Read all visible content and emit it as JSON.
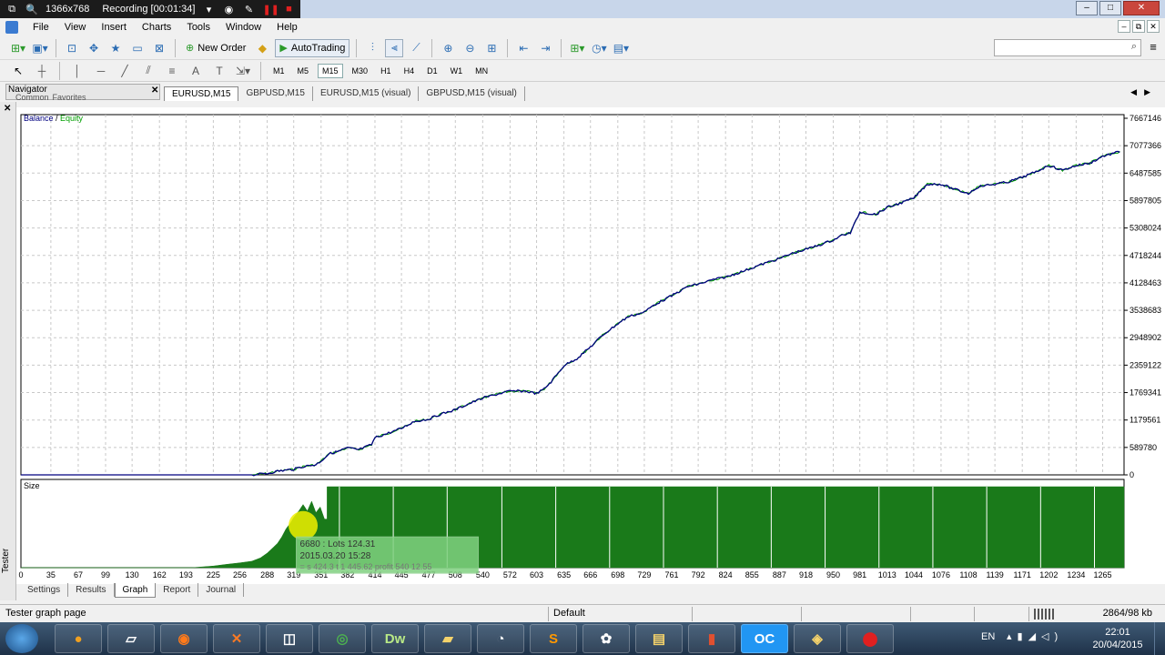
{
  "recorder": {
    "resolution": "1366x768",
    "status": "Recording [00:01:34]"
  },
  "menu": {
    "items": [
      "File",
      "View",
      "Insert",
      "Charts",
      "Tools",
      "Window",
      "Help"
    ]
  },
  "toolbar": {
    "new_order": "New Order",
    "autotrading": "AutoTrading"
  },
  "timeframes": {
    "items": [
      "M1",
      "M5",
      "M15",
      "M30",
      "H1",
      "H4",
      "D1",
      "W1",
      "MN"
    ],
    "active": "M15"
  },
  "navigator": {
    "title": "Navigator",
    "tabs": [
      "Common",
      "Favorites"
    ]
  },
  "chart_tabs": {
    "items": [
      "EURUSD,M15",
      "GBPUSD,M15",
      "EURUSD,M15 (visual)",
      "GBPUSD,M15 (visual)"
    ],
    "active": "EURUSD,M15"
  },
  "colors": {
    "balance": "#000080",
    "equity": "#00a000",
    "lots": "#1a7a1a",
    "highlight": "#f0f000"
  },
  "chart_data": [
    {
      "type": "line",
      "legend": {
        "balance": "Balance",
        "equity": "Equity",
        "separator": "/"
      },
      "y_ticks": [
        "7667146",
        "7077366",
        "6487585",
        "5897805",
        "5308024",
        "4718244",
        "4128463",
        "3538683",
        "2948902",
        "2359122",
        "1769341",
        "1179561",
        "589780",
        "0"
      ],
      "ylim": [
        0,
        7667146
      ],
      "xlim": [
        0,
        1290
      ],
      "grid": true,
      "series": [
        {
          "name": "Balance",
          "x": [
            0,
            100,
            200,
            250,
            270,
            288,
            300,
            319,
            330,
            345,
            351,
            360,
            370,
            382,
            395,
            410,
            414,
            430,
            445,
            460,
            477,
            490,
            508,
            520,
            540,
            560,
            572,
            590,
            603,
            612,
            620,
            635,
            650,
            666,
            680,
            698,
            710,
            729,
            740,
            761,
            780,
            792,
            810,
            824,
            840,
            855,
            870,
            887,
            900,
            918,
            935,
            950,
            960,
            970,
            981,
            1000,
            1013,
            1030,
            1044,
            1060,
            1076,
            1090,
            1108,
            1120,
            1139,
            1155,
            1171,
            1185,
            1202,
            1218,
            1234,
            1250,
            1265,
            1285
          ],
          "values": [
            0,
            0,
            0,
            0,
            0,
            30000,
            80000,
            120000,
            180000,
            220000,
            300000,
            450000,
            500000,
            580000,
            540000,
            650000,
            800000,
            900000,
            1000000,
            1150000,
            1200000,
            1300000,
            1400000,
            1500000,
            1650000,
            1750000,
            1800000,
            1800000,
            1750000,
            1850000,
            2000000,
            2350000,
            2500000,
            2750000,
            3000000,
            3250000,
            3400000,
            3500000,
            3650000,
            3850000,
            4050000,
            4100000,
            4200000,
            4250000,
            4350000,
            4450000,
            4550000,
            4650000,
            4750000,
            4850000,
            4950000,
            5050000,
            5150000,
            5200000,
            5650000,
            5600000,
            5750000,
            5850000,
            5950000,
            6250000,
            6250000,
            6150000,
            6050000,
            6200000,
            6250000,
            6300000,
            6400000,
            6500000,
            6650000,
            6550000,
            6650000,
            6700000,
            6850000,
            6950000
          ]
        },
        {
          "name": "Equity",
          "x": [
            0,
            100,
            200,
            250,
            270,
            288,
            300,
            319,
            330,
            345,
            351,
            360,
            370,
            382,
            395,
            410,
            414,
            430,
            445,
            460,
            477,
            490,
            508,
            520,
            540,
            560,
            572,
            590,
            603,
            612,
            620,
            635,
            650,
            666,
            680,
            698,
            710,
            729,
            740,
            761,
            780,
            792,
            810,
            824,
            840,
            855,
            870,
            887,
            900,
            918,
            935,
            950,
            960,
            970,
            981,
            1000,
            1013,
            1030,
            1044,
            1060,
            1076,
            1090,
            1108,
            1120,
            1139,
            1155,
            1171,
            1185,
            1202,
            1218,
            1234,
            1250,
            1265,
            1285
          ],
          "values": [
            0,
            0,
            0,
            0,
            0,
            30000,
            80000,
            120000,
            180000,
            220000,
            300000,
            450000,
            500000,
            580000,
            540000,
            650000,
            800000,
            900000,
            1000000,
            1150000,
            1200000,
            1300000,
            1400000,
            1500000,
            1650000,
            1750000,
            1800000,
            1800000,
            1750000,
            1850000,
            2000000,
            2350000,
            2500000,
            2750000,
            3000000,
            3250000,
            3400000,
            3500000,
            3650000,
            3850000,
            4050000,
            4100000,
            4200000,
            4250000,
            4350000,
            4450000,
            4550000,
            4650000,
            4750000,
            4850000,
            4950000,
            5050000,
            5150000,
            5200000,
            5650000,
            5600000,
            5750000,
            5850000,
            5950000,
            6250000,
            6250000,
            6150000,
            6050000,
            6200000,
            6250000,
            6300000,
            6400000,
            6500000,
            6650000,
            6550000,
            6650000,
            6700000,
            6850000,
            6950000
          ]
        }
      ]
    },
    {
      "type": "area",
      "title": "Size",
      "x_ticks": [
        "0",
        "35",
        "67",
        "99",
        "130",
        "162",
        "193",
        "225",
        "256",
        "288",
        "319",
        "351",
        "382",
        "414",
        "445",
        "477",
        "508",
        "540",
        "572",
        "603",
        "635",
        "666",
        "698",
        "729",
        "761",
        "792",
        "824",
        "855",
        "887",
        "918",
        "950",
        "981",
        "1013",
        "1044",
        "1076",
        "1108",
        "1139",
        "1171",
        "1202",
        "1234",
        "1265"
      ],
      "xlim": [
        0,
        1290
      ],
      "ylim": [
        0,
        1
      ],
      "series": [
        {
          "name": "Lots",
          "x": [
            0,
            200,
            225,
            240,
            256,
            270,
            280,
            288,
            295,
            300,
            305,
            310,
            315,
            319,
            325,
            330,
            335,
            340,
            345,
            350,
            355,
            358,
            1290
          ],
          "values": [
            0,
            0,
            0.02,
            0.04,
            0.06,
            0.08,
            0.12,
            0.18,
            0.25,
            0.3,
            0.38,
            0.48,
            0.55,
            0.62,
            0.7,
            0.78,
            0.7,
            0.82,
            0.68,
            0.75,
            0.6,
            1,
            1
          ]
        }
      ],
      "tooltip": {
        "line1": "6680 : Lots 124.31",
        "line2": "2015.03.20 15:28",
        "line3": "= s 424.3 t 1 445.62 profit 540 12.55"
      }
    }
  ],
  "bottom_tabs": {
    "items": [
      "Settings",
      "Results",
      "Graph",
      "Report",
      "Journal"
    ],
    "active": "Graph"
  },
  "status": {
    "left": "Tester graph page",
    "profile": "Default",
    "traffic": "2864/98 kb"
  },
  "side": {
    "label": "Tester"
  },
  "taskbar": {
    "icons": [
      "firefox",
      "xampp",
      "window",
      "chrome",
      "dreamweaver",
      "explorer",
      "media",
      "sublime",
      "paint",
      "folder",
      "book",
      "oc",
      "metatrader",
      "record"
    ],
    "dw_label": "Dw",
    "oc_label": "OC",
    "lang": "EN",
    "time": "22:01",
    "date": "20/04/2015"
  }
}
